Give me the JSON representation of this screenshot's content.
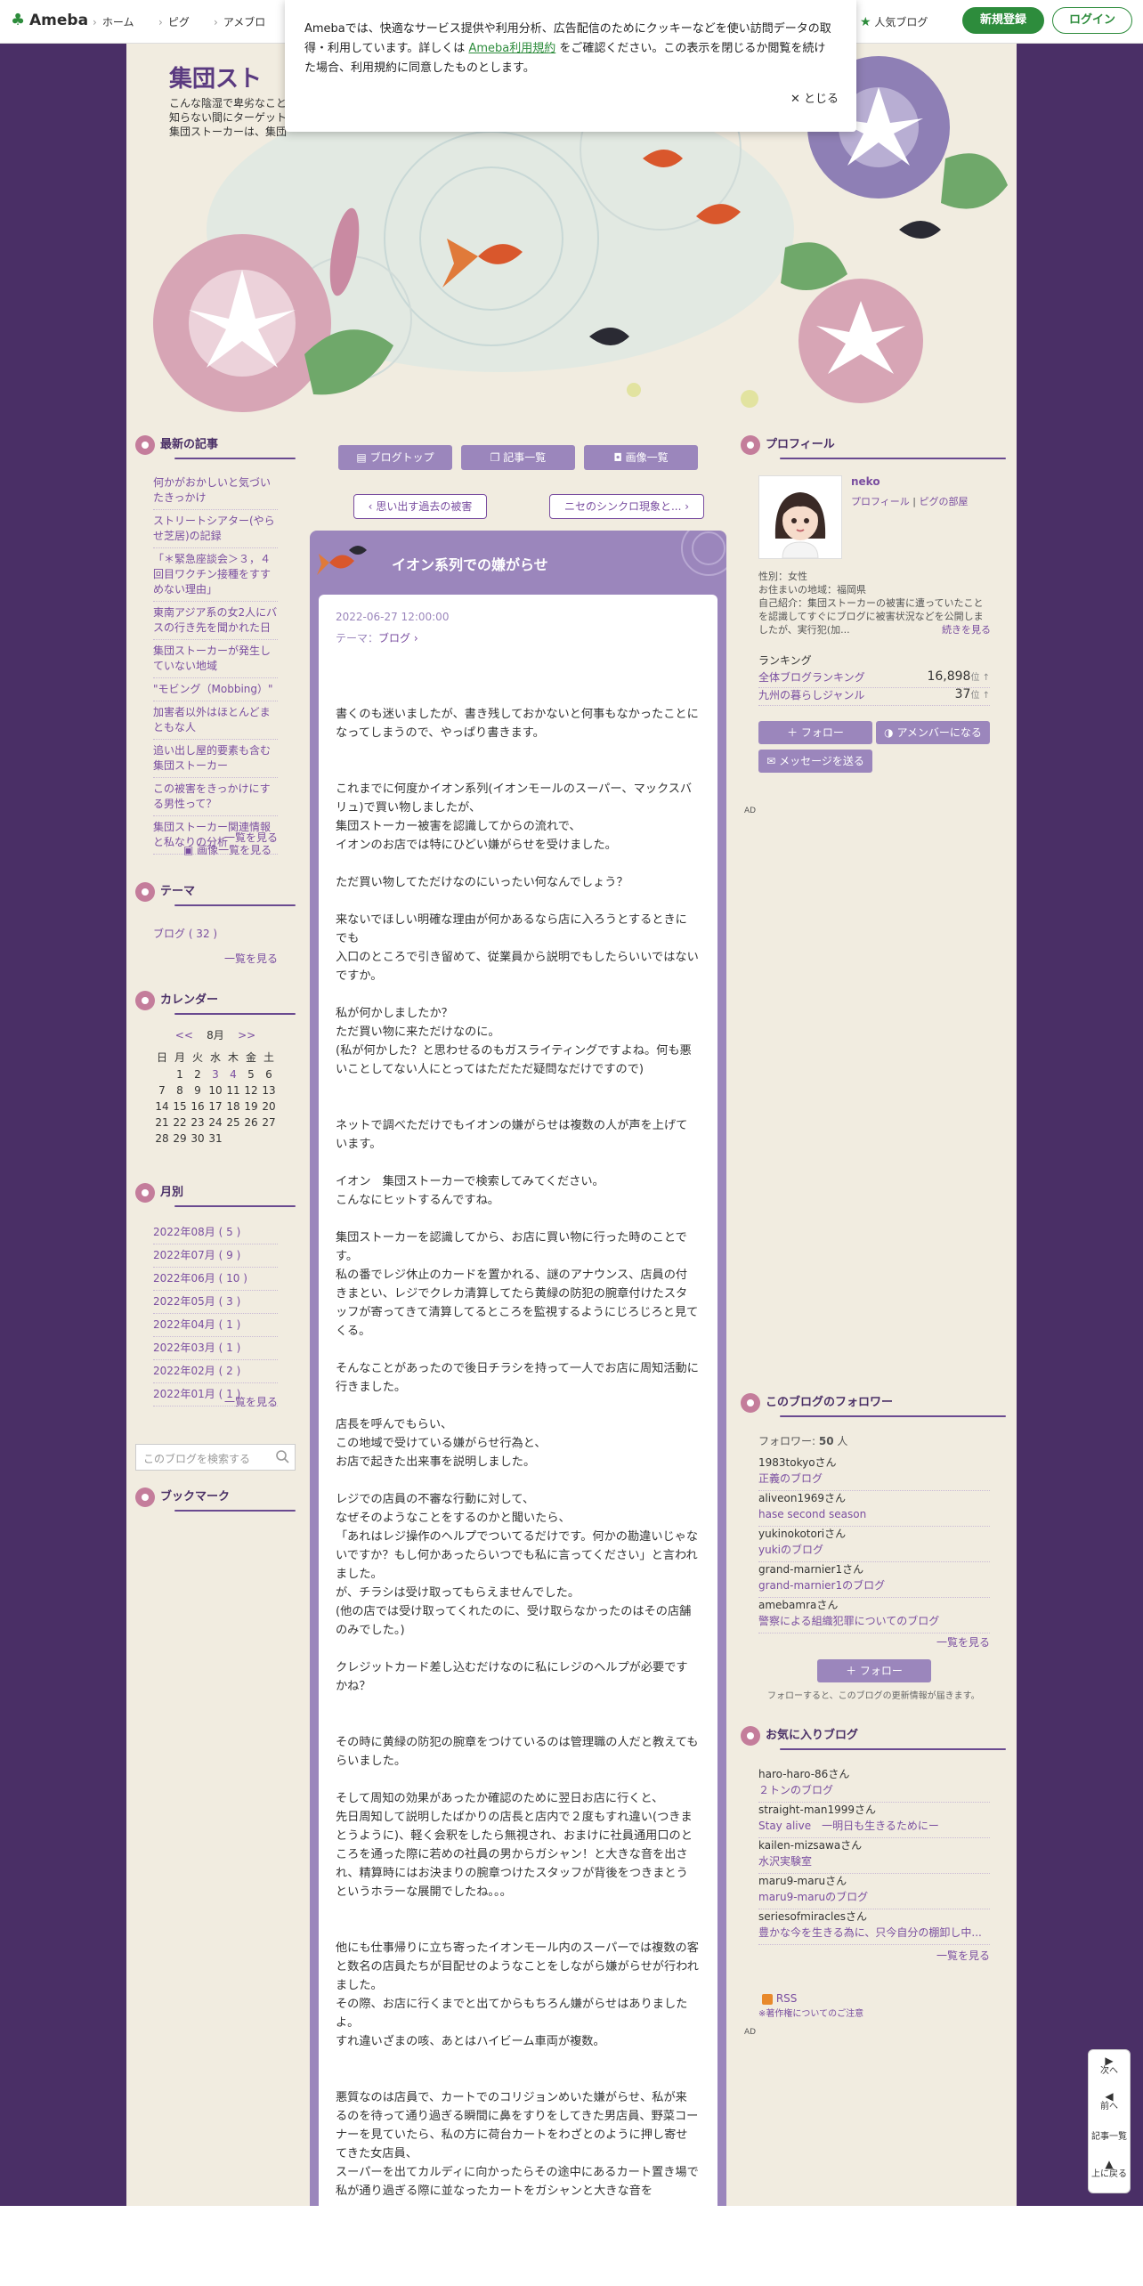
{
  "topbar": {
    "logo": "Ameba",
    "nav": [
      "ホーム",
      "ピグ",
      "アメブロ"
    ],
    "popular_blog": "人気ブログ",
    "signup": "新規登録",
    "login": "ログイン"
  },
  "cookie": {
    "text_before": "Amebaでは、快適なサービス提供や利用分析、広告配信のためにクッキーなどを使い訪問データの取得・利用しています。詳しくは ",
    "link": "Ameba利用規約",
    "text_after": " をご確認ください。この表示を閉じるか閲覧を続けた場合、利用規約に同意したものとします。",
    "close": "✕ とじる"
  },
  "header": {
    "title": "集団スト",
    "desc": "こんな陰湿で卑劣なこと\n知らない間にターゲット\n集団ストーカーは、集団"
  },
  "left": {
    "recent_title": "最新の記事",
    "recent": [
      "何かがおかしいと気づいたきっかけ",
      "ストリートシアター(やらせ芝居)の記録",
      "「＊緊急座談会＞３，４回目ワクチン接種をすすめない理由」",
      "東南アジア系の女2人にバスの行き先を聞かれた日",
      "集団ストーカーが発生していない地域",
      "\"モビング（Mobbing）\"",
      "加害者以外はほとんどまともな人",
      "追い出し屋的要素も含む集団ストーカー",
      "この被害をきっかけにする男性って？",
      "集団ストーカー関連情報と私なりの分析"
    ],
    "recent_more": "一覧を見る",
    "image_more": "画像一覧を見る",
    "theme_title": "テーマ",
    "theme_item": "ブログ ( 32 )",
    "theme_more": "一覧を見る",
    "calendar_title": "カレンダー",
    "cal_prev": "<<",
    "cal_month": "8月",
    "cal_next": ">>",
    "cal_head": [
      "日",
      "月",
      "火",
      "水",
      "木",
      "金",
      "土"
    ],
    "cal_rows": [
      [
        "",
        "1",
        "2",
        "3",
        "4",
        "5",
        "6"
      ],
      [
        "7",
        "8",
        "9",
        "10",
        "11",
        "12",
        "13"
      ],
      [
        "14",
        "15",
        "16",
        "17",
        "18",
        "19",
        "20"
      ],
      [
        "21",
        "22",
        "23",
        "24",
        "25",
        "26",
        "27"
      ],
      [
        "28",
        "29",
        "30",
        "31",
        "",
        "",
        ""
      ]
    ],
    "monthly_title": "月別",
    "monthly": [
      "2022年08月 ( 5 )",
      "2022年07月 ( 9 )",
      "2022年06月 ( 10 )",
      "2022年05月 ( 3 )",
      "2022年04月 ( 1 )",
      "2022年03月 ( 1 )",
      "2022年02月 ( 2 )",
      "2022年01月 ( 1 )"
    ],
    "monthly_more": "一覧を見る",
    "search_placeholder": "このブログを検索する",
    "bookmark_title": "ブックマーク"
  },
  "center": {
    "blog_top": "ブログトップ",
    "entry_list": "記事一覧",
    "image_list": "画像一覧",
    "prev_entry": "思い出す過去の被害",
    "next_entry": "ニセのシンクロ現象と...",
    "title": "イオン系列での嫌がらせ",
    "date": "2022-06-27 12:00:00",
    "theme_label": "テーマ：",
    "theme": "ブログ",
    "paragraphs": [
      "書くのも迷いましたが、書き残しておかないと何事もなかったことになってしまうので、やっぱり書きます。",
      "これまでに何度かイオン系列(イオンモールのスーパー、マックスバリュ)で買い物しましたが、\n集団ストーカー被害を認識してからの流れで、\nイオンのお店では特にひどい嫌がらせを受けました。",
      "ただ買い物してただけなのにいったい何なんでしょう？",
      "来ないでほしい明確な理由が何かあるなら店に入ろうとするときにでも\n入口のところで引き留めて、従業員から説明でもしたらいいではないですか。",
      "私が何かしましたか？\nただ買い物に来ただけなのに。\n(私が何かした？と思わせるのもガスライティングですよね。何も悪いことしてない人にとってはただただ疑問なだけですので)",
      "ネットで調べただけでもイオンの嫌がらせは複数の人が声を上げています。",
      "イオン　集団ストーカーで検索してみてください。\nこんなにヒットするんですね。",
      "集団ストーカーを認識してから、お店に買い物に行った時のことです。\n私の番でレジ休止のカードを置かれる、謎のアナウンス、店員の付きまとい、レジでクレカ清算してたら黄緑の防犯の腕章付けたスタッフが寄ってきて清算してるところを監視するようにじろじろと見てくる。",
      "そんなことがあったので後日チラシを持って一人でお店に周知活動に行きました。",
      "店長を呼んでもらい、\nこの地域で受けている嫌がらせ行為と、\nお店で起きた出来事を説明しました。",
      "レジでの店員の不審な行動に対して、\nなぜそのようなことをするのかと聞いたら、\n「あれはレジ操作のヘルプでついてるだけです。何かの勘違いじゃないですか？もし何かあったらいつでも私に言ってください」と言われました。\nが、チラシは受け取ってもらえませんでした。\n(他の店では受け取ってくれたのに、受け取らなかったのはその店舗のみでした。)",
      "クレジットカード差し込むだけなのに私にレジのヘルプが必要ですかね？",
      "その時に黄緑の防犯の腕章をつけているのは管理職の人だと教えてもらいました。",
      "そして周知の効果があったか確認のために翌日お店に行くと、\n先日周知して説明したばかりの店長と店内で２度もすれ違い(つきまとうように)、軽く会釈をしたら無視され、おまけに社員通用口のところを通った際に若めの社員の男からガシャン！と大きな音を出され、精算時にはお決まりの腕章つけたスタッフが背後をつきまとうというホラーな展開でしたね。。。",
      "他にも仕事帰りに立ち寄ったイオンモール内のスーパーでは複数の客と数名の店員たちが目配せのようなことをしながら嫌がらせが行われました。\nその際、お店に行くまでと出てからもちろん嫌がらせはありましたよ。\nすれ違いざまの咳、あとはハイビーム車両が複数。",
      "悪質なのは店員で、カートでのコリジョンめいた嫌がらせ、私が来るのを待って通り過ぎる瞬間に鼻をすりをしてきた男店員、野菜コーナーを見ていたら、私の方に荷台カートをわざとのように押し寄せてきた女店員、\nスーパーを出てカルディに向かったらその途中にあるカート置き場で私が通り過ぎる際に並なったカートをガシャンと大きな音を"
    ]
  },
  "right": {
    "profile_title": "プロフィール",
    "name": "neko",
    "profile_link": "プロフィール",
    "pig_link": "ピグの部屋",
    "gender": "性別：女性",
    "region": "お住まいの地域：福岡県",
    "intro": "自己紹介：集団ストーカーの被害に遭っていたことを認識してすぐにブログに被害状況などを公開しましたが、実行犯(加...",
    "intro_more": "続きを見る",
    "ranking_title": "ランキング",
    "rankings": [
      {
        "label": "全体ブログランキング",
        "value": "16,898",
        "unit": "位 ↑"
      },
      {
        "label": "九州の暮らしジャンル",
        "value": "37",
        "unit": "位 ↑"
      }
    ],
    "follow_btn": "フォロー",
    "member_btn": "アメンバーになる",
    "message_btn": "メッセージを送る",
    "ad1": "AD",
    "followers_title": "このブログのフォロワー",
    "follower_count_label": "フォロワー:",
    "follower_count": "50",
    "follower_count_unit": "人",
    "followers": [
      {
        "user": "1983tokyoさん",
        "blog": "正義のブログ"
      },
      {
        "user": "aliveon1969さん",
        "blog": "hase second season"
      },
      {
        "user": "yukinokotoriさん",
        "blog": "yukiのブログ"
      },
      {
        "user": "grand-marnier1さん",
        "blog": "grand-marnier1のブログ"
      },
      {
        "user": "amebamraさん",
        "blog": "警察による組織犯罪についてのブログ"
      }
    ],
    "followers_more": "一覧を見る",
    "follow_btn2": "フォロー",
    "follow_note": "フォローすると、このブログの更新情報が届きます。",
    "fav_title": "お気に入りブログ",
    "favs": [
      {
        "user": "haro-haro-86さん",
        "blog": "２トンのブログ"
      },
      {
        "user": "straight-man1999さん",
        "blog": "Stay alive　一明日も生きるためにー"
      },
      {
        "user": "kailen-mizsawaさん",
        "blog": "水沢実験室"
      },
      {
        "user": "maru9-maruさん",
        "blog": "maru9-maruのブログ"
      },
      {
        "user": "seriesofmiraclesさん",
        "blog": "豊かな今を生きる為に、只今自分の棚卸し中..."
      }
    ],
    "fav_more": "一覧を見る",
    "rss": "RSS",
    "copyright": "※著作権についてのご注意",
    "ad2": "AD"
  },
  "floatnav": {
    "next": "次へ",
    "prev": "前へ",
    "list": "記事一覧",
    "top": "上に戻る"
  },
  "colors": {
    "ameba_green": "#2d8c3c",
    "purple_dark": "#4a2f66",
    "purple_mid": "#9b86bc",
    "purple_link": "#7a4ea0",
    "paper": "#f1ece0"
  }
}
